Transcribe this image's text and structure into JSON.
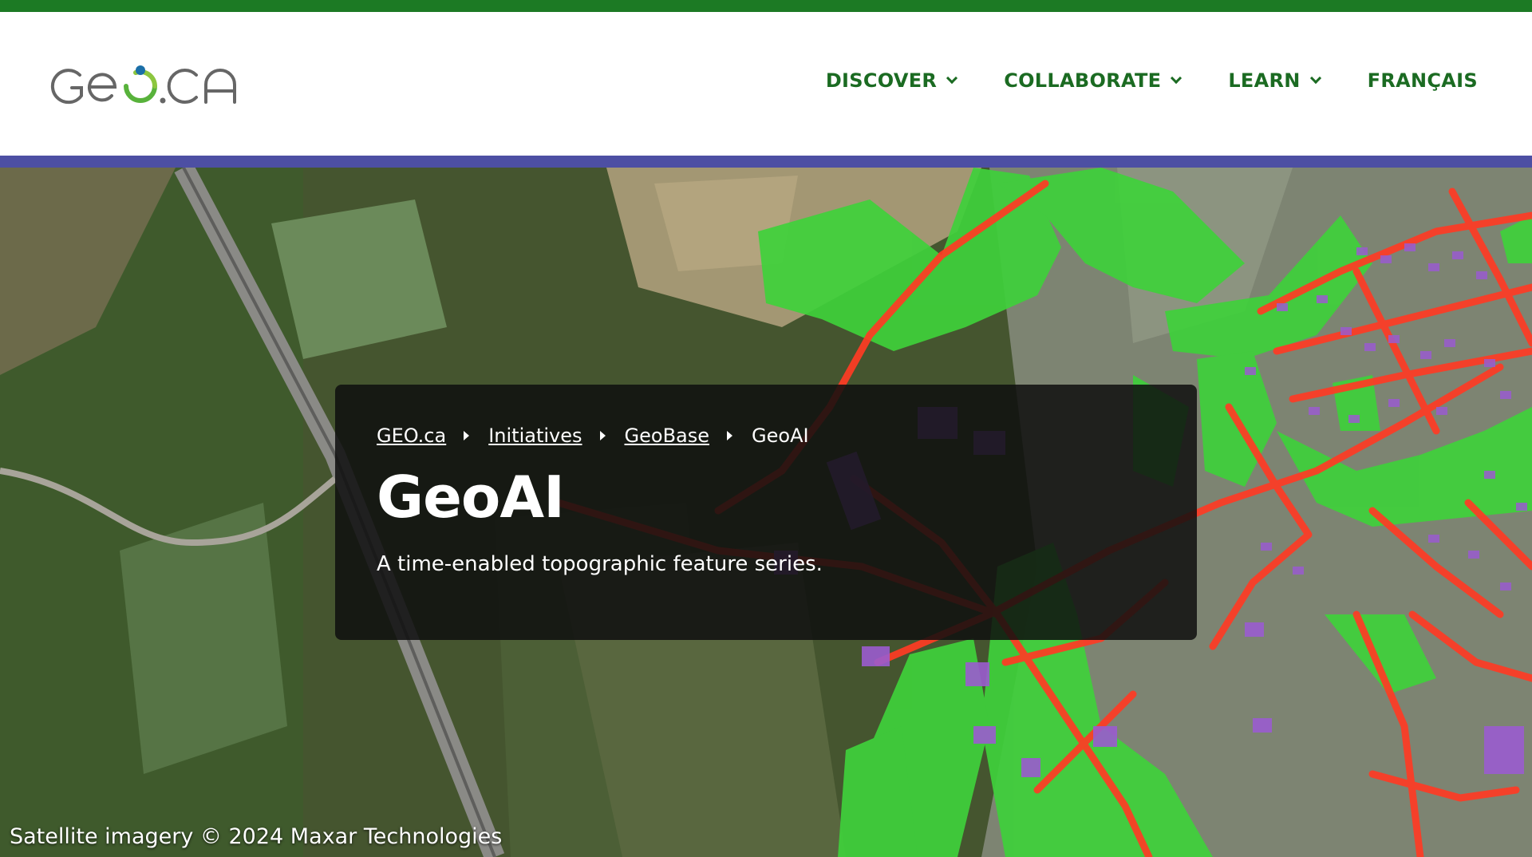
{
  "header": {
    "logo_text": "GEO.CA",
    "nav": [
      {
        "label": "DISCOVER",
        "has_dropdown": true
      },
      {
        "label": "COLLABORATE",
        "has_dropdown": true
      },
      {
        "label": "LEARN",
        "has_dropdown": true
      },
      {
        "label": "FRANÇAIS",
        "has_dropdown": false
      }
    ]
  },
  "breadcrumb": {
    "items": [
      "GEO.ca",
      "Initiatives",
      "GeoBase"
    ],
    "current": "GeoAI"
  },
  "hero": {
    "title": "GeoAI",
    "subtitle": "A time-enabled topographic feature series.",
    "credit": "Satellite imagery © 2024 Maxar Technologies"
  },
  "colors": {
    "top_stripe": "#1c7a24",
    "nav_text": "#1b6b22",
    "accent_bar": "#4d4fa3",
    "panel_bg": "#0f0f0f",
    "vegetation_overlay": "#3fd13b",
    "road_overlay": "#ff3b24",
    "building_overlay": "#9a5ccf"
  },
  "icons": {
    "dropdown": "chevron-down-icon",
    "breadcrumb_separator": "caret-right-icon"
  }
}
